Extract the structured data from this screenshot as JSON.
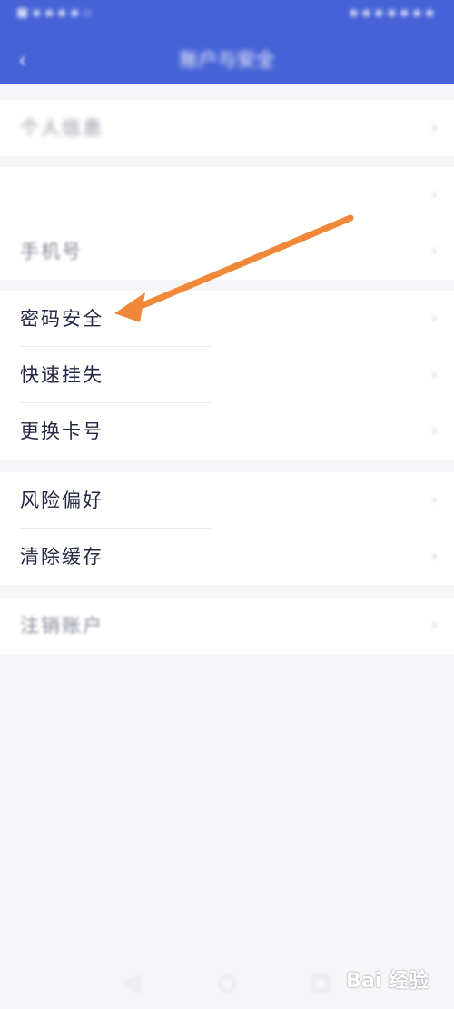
{
  "header": {
    "status_left": "■ ▪ ▪ ▪ ▪ ▫",
    "status_right": "▪ ▪ ▪ ▪ ▪ ▪ ▪",
    "back_icon": "chevron-left-icon",
    "title": "账户与安全"
  },
  "sections": [
    {
      "rows": [
        {
          "label": "个人信息",
          "value": "",
          "blurred": true
        }
      ]
    },
    {
      "rows": [
        {
          "label": "",
          "value": "",
          "blurred": true
        },
        {
          "label": "手机号",
          "value": "",
          "blurred": false
        }
      ]
    },
    {
      "rows": [
        {
          "label": "密码安全",
          "value": ""
        },
        {
          "label": "快速挂失",
          "value": ""
        },
        {
          "label": "更换卡号",
          "value": ""
        }
      ]
    },
    {
      "rows": [
        {
          "label": "风险偏好",
          "value": ""
        },
        {
          "label": "清除缓存",
          "value": ""
        }
      ]
    },
    {
      "rows": [
        {
          "label": "注销账户",
          "value": ""
        }
      ]
    }
  ],
  "logout_label": "",
  "chevron_glyph": "›",
  "watermark_text": "Bai 经验",
  "colors": {
    "header_bg": "#4562d6",
    "arrow": "#f0883a",
    "logout_text": "#e4453a"
  }
}
